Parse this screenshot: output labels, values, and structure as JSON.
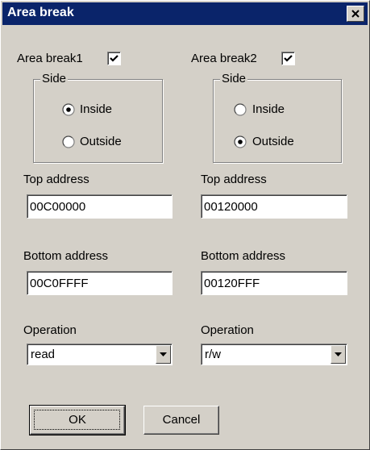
{
  "window": {
    "title": "Area break"
  },
  "area1": {
    "label": "Area break1",
    "checked": true,
    "side_legend": "Side",
    "side_options": [
      "Inside",
      "Outside"
    ],
    "side_selected": "Inside",
    "top_label": "Top address",
    "top_value": "00C00000",
    "bottom_label": "Bottom address",
    "bottom_value": "00C0FFFF",
    "operation_label": "Operation",
    "operation_value": "read"
  },
  "area2": {
    "label": "Area break2",
    "checked": true,
    "side_legend": "Side",
    "side_options": [
      "Inside",
      "Outside"
    ],
    "side_selected": "Outside",
    "top_label": "Top address",
    "top_value": "00120000",
    "bottom_label": "Bottom address",
    "bottom_value": "00120FFF",
    "operation_label": "Operation",
    "operation_value": "r/w"
  },
  "buttons": {
    "ok_label": "OK",
    "cancel_label": "Cancel"
  },
  "icons": {
    "close": "close-icon",
    "check": "checkmark-icon",
    "dropdown": "chevron-down-icon"
  }
}
